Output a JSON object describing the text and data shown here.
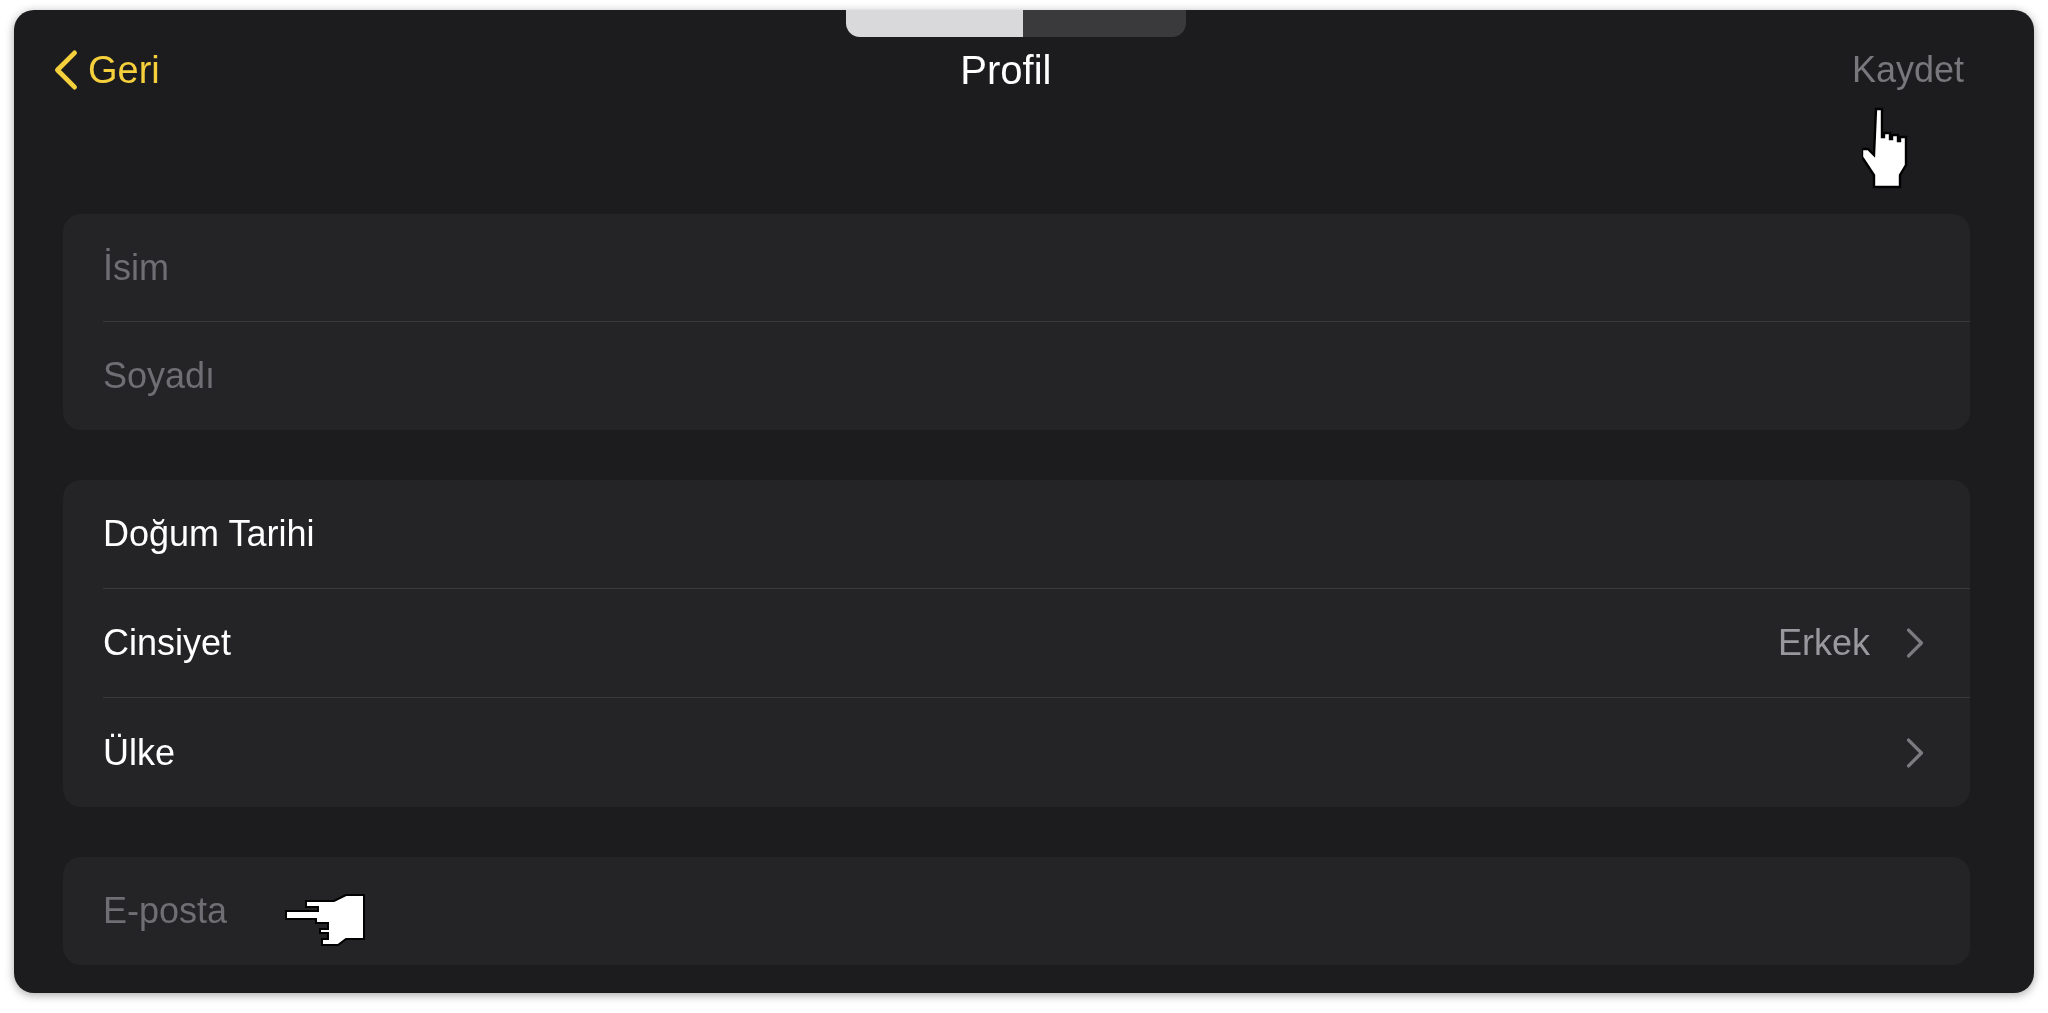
{
  "nav": {
    "back": "Geri",
    "title": "Profil",
    "save": {
      "label": "Kaydet",
      "disabled": true
    }
  },
  "name_group": [
    {
      "placeholder": "İsim"
    },
    {
      "placeholder": "Soyadı"
    }
  ],
  "detail_group": [
    {
      "kind": "plain",
      "label": "Doğum Tarihi"
    },
    {
      "kind": "disclosure",
      "label": "Cinsiyet",
      "value": "Erkek"
    },
    {
      "kind": "disclosure",
      "label": "Ülke"
    }
  ],
  "email_group": [
    {
      "placeholder": "E-posta"
    }
  ]
}
